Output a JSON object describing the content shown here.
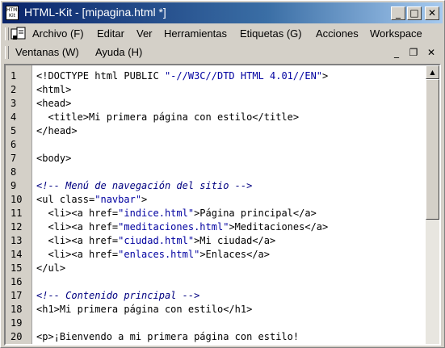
{
  "window": {
    "title": "HTML-Kit - [mipagina.html *]",
    "app_icon_label": "HTML Kit",
    "controls": {
      "minimize": "_",
      "maximize": "□",
      "close": "✕"
    }
  },
  "menu": {
    "row1": [
      "Archivo (F)",
      "Editar",
      "Ver",
      "Herramientas",
      "Etiquetas (G)",
      "Acciones",
      "Workspace"
    ],
    "row2": [
      "Ventanas (W)",
      "Ayuda (H)"
    ],
    "mdi_controls": {
      "minimize": "_",
      "restore": "❐",
      "close": "✕"
    }
  },
  "editor": {
    "lines": [
      {
        "n": "1",
        "t": "<!DOCTYPE html PUBLIC \"-//W3C//DTD HTML 4.01//EN\">"
      },
      {
        "n": "2",
        "t": "<html>"
      },
      {
        "n": "3",
        "t": "<head>"
      },
      {
        "n": "4",
        "t": "  <title>Mi primera página con estilo</title>"
      },
      {
        "n": "5",
        "t": "</head>"
      },
      {
        "n": "6",
        "t": ""
      },
      {
        "n": "7",
        "t": "<body>"
      },
      {
        "n": "8",
        "t": ""
      },
      {
        "n": "9",
        "t": "<!-- Menú de navegación del sitio -->"
      },
      {
        "n": "10",
        "t": "<ul class=\"navbar\">"
      },
      {
        "n": "11",
        "t": "  <li><a href=\"indice.html\">Página principal</a>"
      },
      {
        "n": "12",
        "t": "  <li><a href=\"meditaciones.html\">Meditaciones</a>"
      },
      {
        "n": "13",
        "t": "  <li><a href=\"ciudad.html\">Mi ciudad</a>"
      },
      {
        "n": "14",
        "t": "  <li><a href=\"enlaces.html\">Enlaces</a>"
      },
      {
        "n": "15",
        "t": "</ul>"
      },
      {
        "n": "16",
        "t": ""
      },
      {
        "n": "17",
        "t": "<!-- Contenido principal -->"
      },
      {
        "n": "18",
        "t": "<h1>Mi primera página con estilo</h1>"
      },
      {
        "n": "19",
        "t": ""
      },
      {
        "n": "20",
        "t": "<p>¡Bienvendo a mi primera página con estilo!"
      }
    ]
  },
  "scrollbar": {
    "up_arrow": "▲"
  }
}
